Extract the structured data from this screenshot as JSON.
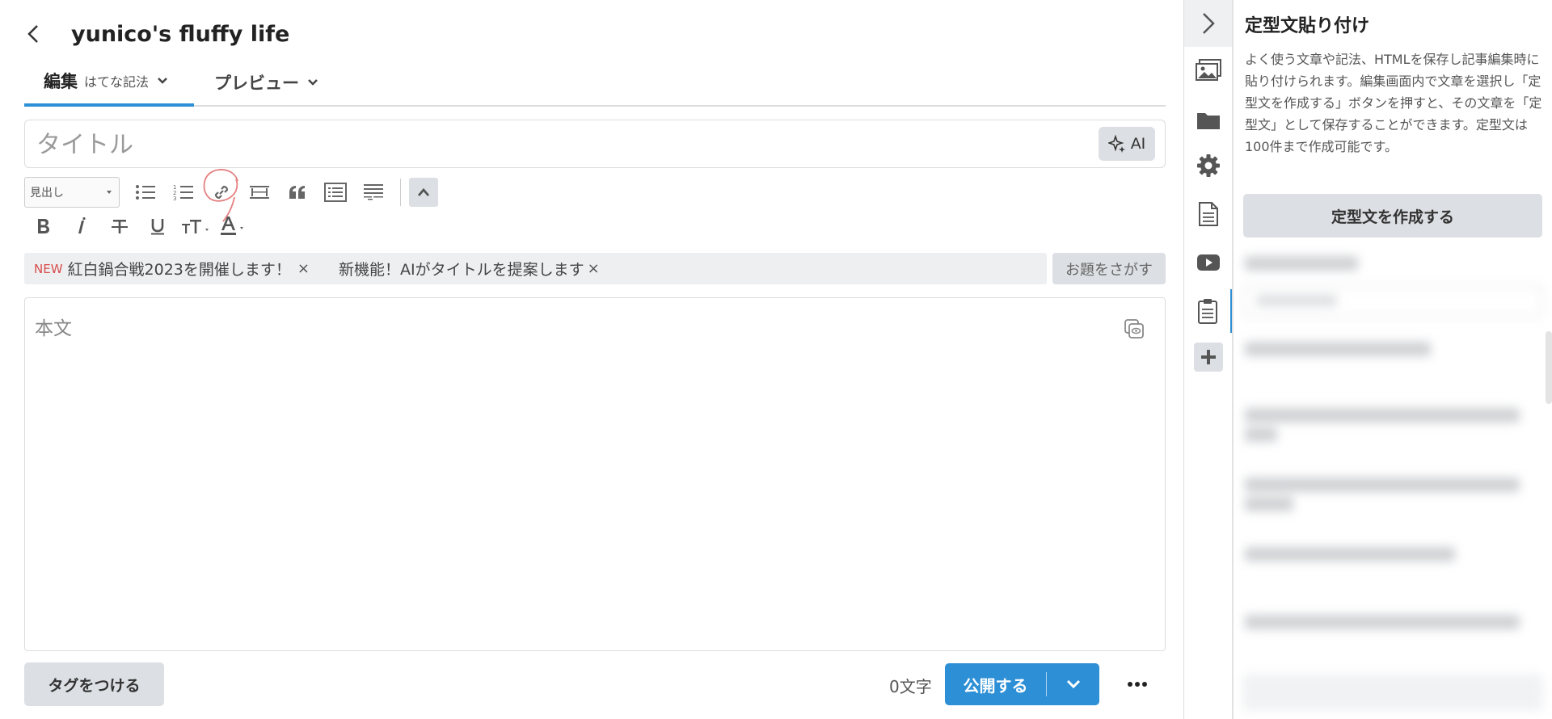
{
  "header": {
    "blog_title": "yunico's fluffy life"
  },
  "tabs": {
    "edit_label": "編集",
    "edit_mode": "はてな記法",
    "preview_label": "プレビュー"
  },
  "editor": {
    "title_placeholder": "タイトル",
    "ai_label": "AI",
    "heading_select_value": "見出し",
    "body_placeholder": "本文",
    "char_count": "0文字"
  },
  "banner": {
    "new_badge": "NEW",
    "items": [
      "紅白鍋合戦2023を開催します！",
      "新機能！AIがタイトルを提案します"
    ],
    "close_glyph": "×",
    "topic_button": "お題をさがす"
  },
  "footer": {
    "tag_button": "タグをつける",
    "publish_button": "公開する"
  },
  "panel": {
    "title": "定型文貼り付け",
    "description": "よく使う文章や記法、HTMLを保存し記事編集時に貼り付けられます。編集画面内で文章を選択し「定型文を作成する」ボタンを押すと、その文章を「定型文」として保存することができます。定型文は100件まで作成可能です。",
    "create_button": "定型文を作成する"
  },
  "colors": {
    "accent": "#2d8fd5",
    "button_gray": "#dcdfe3",
    "new_badge": "#d94c4c",
    "annotation_circle": "#e0686a"
  },
  "icons": {
    "toolbar": [
      "bullet-list-icon",
      "numbered-list-icon",
      "link-icon",
      "read-more-icon",
      "quote-icon",
      "table-of-contents-icon",
      "footnote-icon",
      "collapse-toolbar-icon"
    ],
    "format": [
      "bold-icon",
      "italic-icon",
      "strikethrough-icon",
      "underline-icon",
      "text-size-icon",
      "text-color-icon"
    ],
    "rail": [
      "collapse-panel-icon",
      "photo-icon",
      "folder-icon",
      "gear-icon",
      "document-icon",
      "youtube-icon",
      "clipboard-icon",
      "plus-icon"
    ]
  }
}
